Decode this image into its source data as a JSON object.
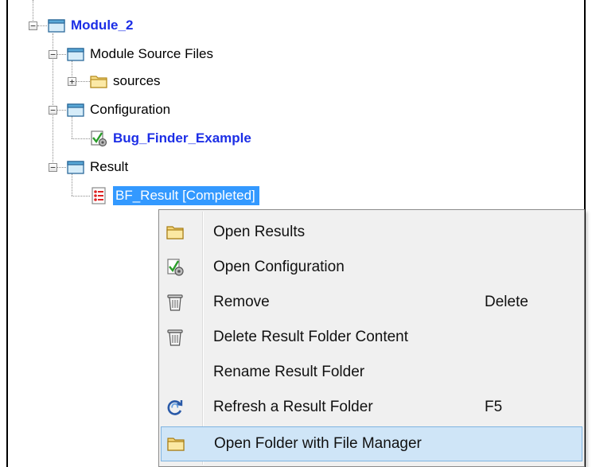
{
  "tree": {
    "module": {
      "label": "Module_2",
      "icon": "project-folder-icon",
      "expanded": true
    },
    "source_files": {
      "label": "Module Source Files",
      "icon": "source-files-folder-icon",
      "expanded": true
    },
    "sources": {
      "label": "sources",
      "icon": "folder-icon",
      "expanded": false
    },
    "configuration": {
      "label": "Configuration",
      "icon": "configuration-folder-icon",
      "expanded": true
    },
    "bug_finder": {
      "label": "Bug_Finder_Example",
      "icon": "bug-finder-config-icon"
    },
    "result": {
      "label": "Result",
      "icon": "result-folder-icon",
      "expanded": true
    },
    "bf_result": {
      "label": "BF_Result [Completed]",
      "icon": "result-list-icon",
      "selected": true
    }
  },
  "context_menu": {
    "items": [
      {
        "label": "Open Results",
        "icon": "folder-icon",
        "shortcut": ""
      },
      {
        "label": "Open Configuration",
        "icon": "configuration-icon",
        "shortcut": ""
      },
      {
        "label": "Remove",
        "icon": "trash-icon",
        "shortcut": "Delete"
      },
      {
        "label": "Delete Result Folder Content",
        "icon": "trash-icon",
        "shortcut": ""
      },
      {
        "label": "Rename Result Folder",
        "icon": "",
        "shortcut": ""
      },
      {
        "label": "Refresh a Result Folder",
        "icon": "refresh-icon",
        "shortcut": "F5"
      },
      {
        "label": "Open Folder with File Manager",
        "icon": "folder-icon",
        "shortcut": "",
        "highlighted": true
      }
    ]
  },
  "colors": {
    "selection": "#3399ff",
    "link_blue": "#1c2ee6",
    "menu_bg": "#f0f0f0",
    "menu_hover": "#cfe5f7"
  }
}
